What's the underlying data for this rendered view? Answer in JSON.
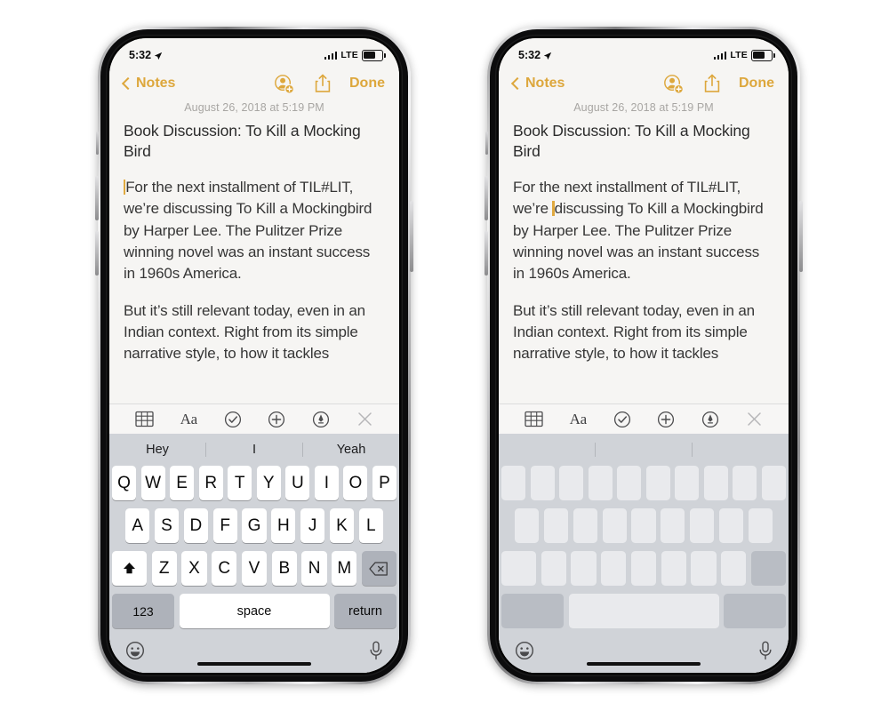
{
  "app": {
    "name": "Notes",
    "accent_color": "#dda73c",
    "screen_bg": "#f6f5f3",
    "keyboard_bg": "#d0d3d8"
  },
  "status_bar": {
    "time": "5:32",
    "location_icon": "location-arrow-icon",
    "signal_icon": "cellular-bars-icon",
    "network": "LTE",
    "battery_icon": "battery-icon"
  },
  "nav_bar": {
    "back_label": "Notes",
    "back_chevron_icon": "chevron-left-icon",
    "add_people_icon": "person-add-icon",
    "share_icon": "share-icon",
    "done_label": "Done"
  },
  "note": {
    "date": "August 26, 2018 at 5:19 PM",
    "title": "Book Discussion: To Kill a Mocking Bird",
    "paragraph_1_before_caret": "",
    "paragraph_1": "For the next installment of TIL#LIT, we’re discussing To Kill a Mockingbird by Harper Lee. The Pulitzer Prize winning novel was an instant success in 1960s America.",
    "paragraph_2": "But it’s still relevant today, even in an Indian context. Right from its simple narrative style, to how it tackles"
  },
  "note_right": {
    "paragraph_1_part_a": "For the next installment of TIL#LIT, we’re ",
    "paragraph_1_part_b": "discussing To Kill a Mockingbird by Harper Lee. The Pulitzer Prize winning novel was an instant success in 1960s America."
  },
  "format_toolbar": {
    "items": [
      {
        "name": "table-icon",
        "label": ""
      },
      {
        "name": "text-format-icon",
        "label": "Aa"
      },
      {
        "name": "checklist-icon",
        "label": ""
      },
      {
        "name": "add-attachment-icon",
        "label": ""
      },
      {
        "name": "markup-pen-icon",
        "label": ""
      },
      {
        "name": "close-icon",
        "label": ""
      }
    ]
  },
  "keyboard_left": {
    "predictions": [
      "Hey",
      "I",
      "Yeah"
    ],
    "row1": [
      "Q",
      "W",
      "E",
      "R",
      "T",
      "Y",
      "U",
      "I",
      "O",
      "P"
    ],
    "row2": [
      "A",
      "S",
      "D",
      "F",
      "G",
      "H",
      "J",
      "K",
      "L"
    ],
    "row3": [
      "Z",
      "X",
      "C",
      "V",
      "B",
      "N",
      "M"
    ],
    "shift_icon": "shift-up-icon",
    "delete_icon": "backspace-icon",
    "numbers_label": "123",
    "space_label": "space",
    "return_label": "return",
    "emoji_icon": "emoji-smiley-icon",
    "dictation_icon": "microphone-icon"
  },
  "keyboard_right": {
    "predictions": [
      "",
      "",
      ""
    ],
    "row1": [
      "",
      "",
      "",
      "",
      "",
      "",
      "",
      "",
      "",
      ""
    ],
    "row2": [
      "",
      "",
      "",
      "",
      "",
      "",
      "",
      "",
      ""
    ],
    "row3": [
      "",
      "",
      "",
      "",
      "",
      "",
      ""
    ],
    "shift_icon": "shift-up-icon",
    "delete_icon": "backspace-icon",
    "numbers_label": "",
    "space_label": "",
    "return_label": "",
    "emoji_icon": "emoji-smiley-icon",
    "dictation_icon": "microphone-icon"
  }
}
